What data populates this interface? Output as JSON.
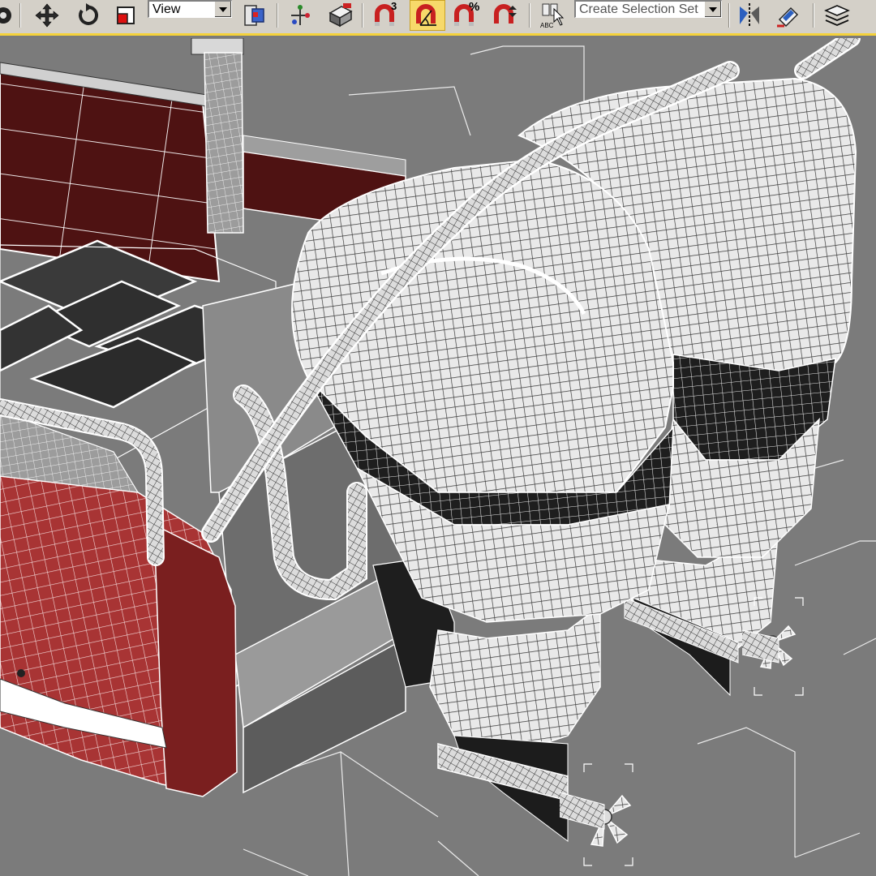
{
  "toolbar": {
    "view_dropdown": {
      "value": "View"
    },
    "selection_set_dropdown": {
      "placeholder": "Create Selection Set"
    },
    "angle_snap_label": "3",
    "percent_snap_label": "%",
    "accent_color": "#f5d23a",
    "buttons": [
      {
        "name": "render-icon"
      },
      {
        "name": "select-move-icon"
      },
      {
        "name": "select-rotate-icon"
      },
      {
        "name": "select-scale-icon"
      },
      {
        "name": "select-manipulate-icon"
      },
      {
        "name": "use-pivot-icon"
      },
      {
        "name": "keyboard-shortcut-icon"
      },
      {
        "name": "snap-3d-icon"
      },
      {
        "name": "angle-snap-icon"
      },
      {
        "name": "percent-snap-icon"
      },
      {
        "name": "spinner-snap-icon"
      },
      {
        "name": "edit-named-selection-icon"
      },
      {
        "name": "mirror-icon"
      },
      {
        "name": "align-icon"
      },
      {
        "name": "layer-manager-icon"
      }
    ]
  },
  "viewport": {
    "background_color": "#7b7b7b",
    "wire_color": "#ffffff",
    "hull_color": "#7a1f1f"
  }
}
